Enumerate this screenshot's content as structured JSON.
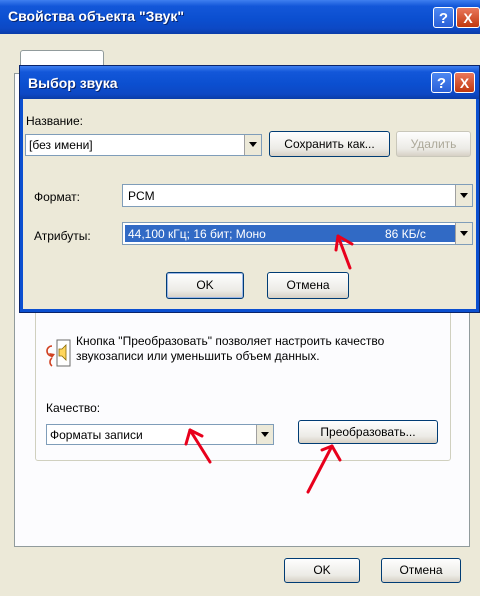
{
  "outer_window": {
    "title": "Свойства объекта \"Звук\"",
    "help_button": "?",
    "close_button": "X",
    "info_text": "Кнопка \"Преобразовать\" позволяет настроить качество звукозаписи или уменьшить объем данных.",
    "quality_label": "Качество:",
    "quality_value": "Форматы записи",
    "convert_button": "Преобразовать...",
    "ok_button": "OK",
    "cancel_button": "Отмена"
  },
  "sound_dialog": {
    "title": "Выбор звука",
    "help_button": "?",
    "close_button": "X",
    "name_label": "Название:",
    "name_value": "[без имени]",
    "save_as_button": "Сохранить как...",
    "delete_button": "Удалить",
    "format_label": "Формат:",
    "format_value": "PCM",
    "attributes_label": "Атрибуты:",
    "attributes_value": "44,100 кГц; 16 бит; Моно",
    "attributes_rate": "86 КБ/с",
    "ok_button": "OK",
    "cancel_button": "Отмена"
  },
  "colors": {
    "title_bar": "#0b4fd0",
    "panel": "#ece9d8",
    "selection": "#316ac5",
    "annotation": "#e8001c"
  }
}
